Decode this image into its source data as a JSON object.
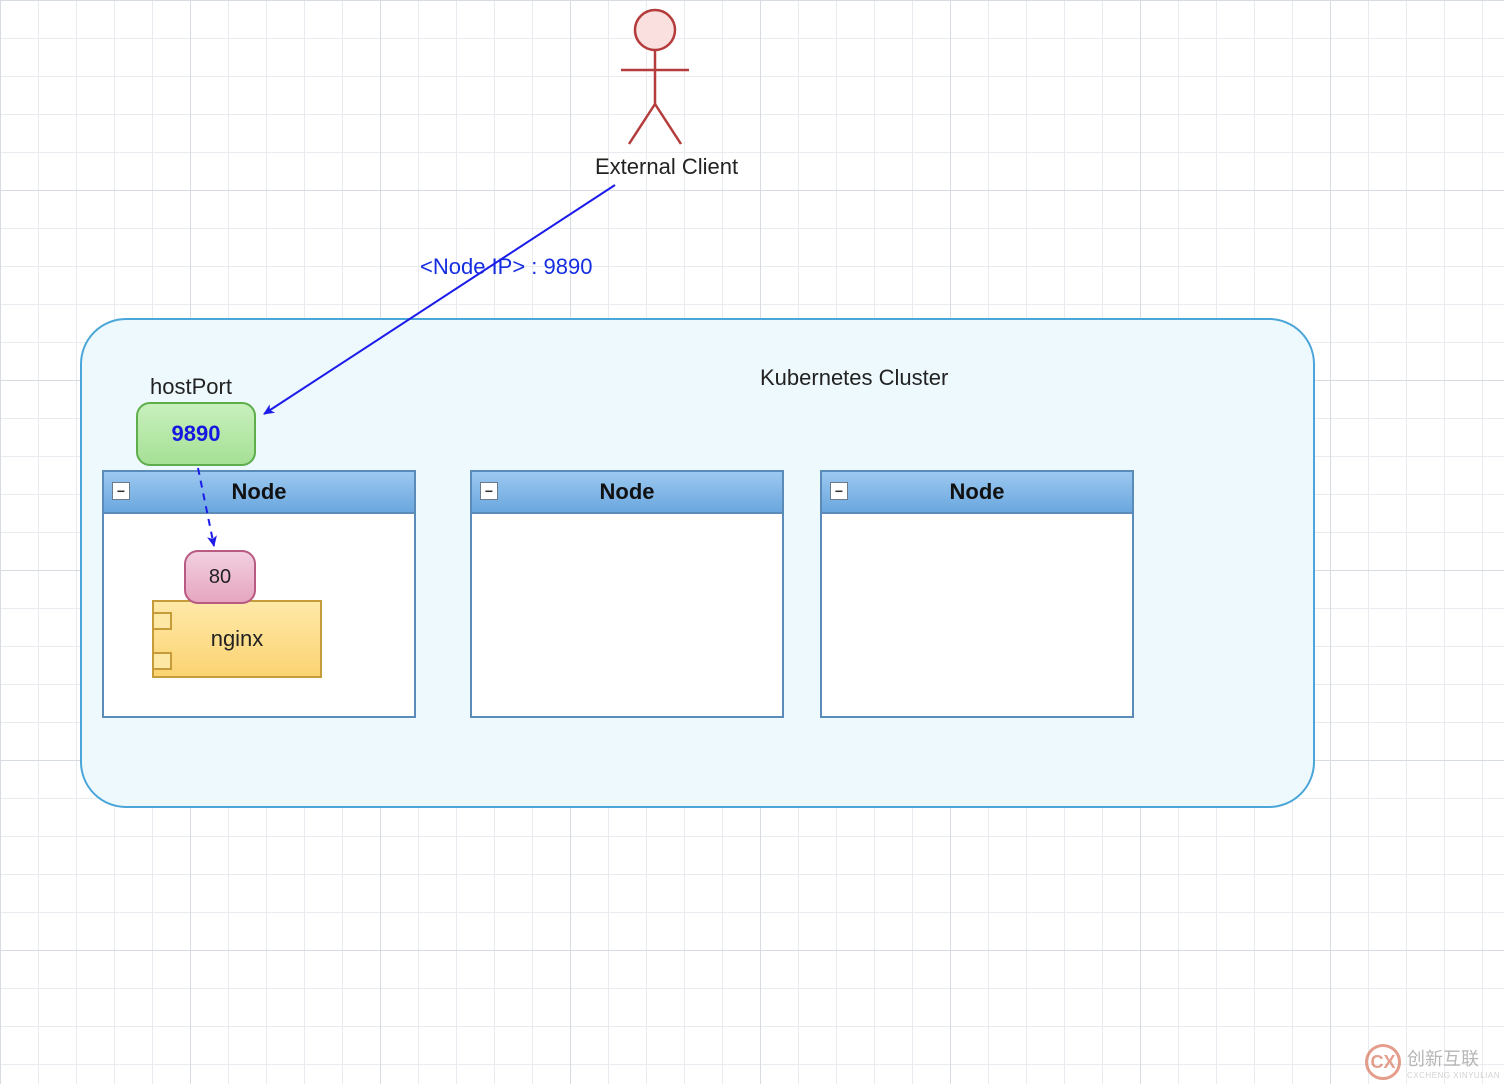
{
  "actor": {
    "label": "External Client"
  },
  "cluster": {
    "title": "Kubernetes Cluster"
  },
  "hostport": {
    "label": "hostPort",
    "value": "9890"
  },
  "nodes": [
    {
      "title": "Node"
    },
    {
      "title": "Node"
    },
    {
      "title": "Node"
    }
  ],
  "container": {
    "name": "nginx",
    "port": "80"
  },
  "arrow": {
    "label": "<Node IP> : 9890"
  },
  "watermark": {
    "text": "创新互联",
    "sub": "CXCHENG XINYULIAN",
    "logo": "CX"
  }
}
